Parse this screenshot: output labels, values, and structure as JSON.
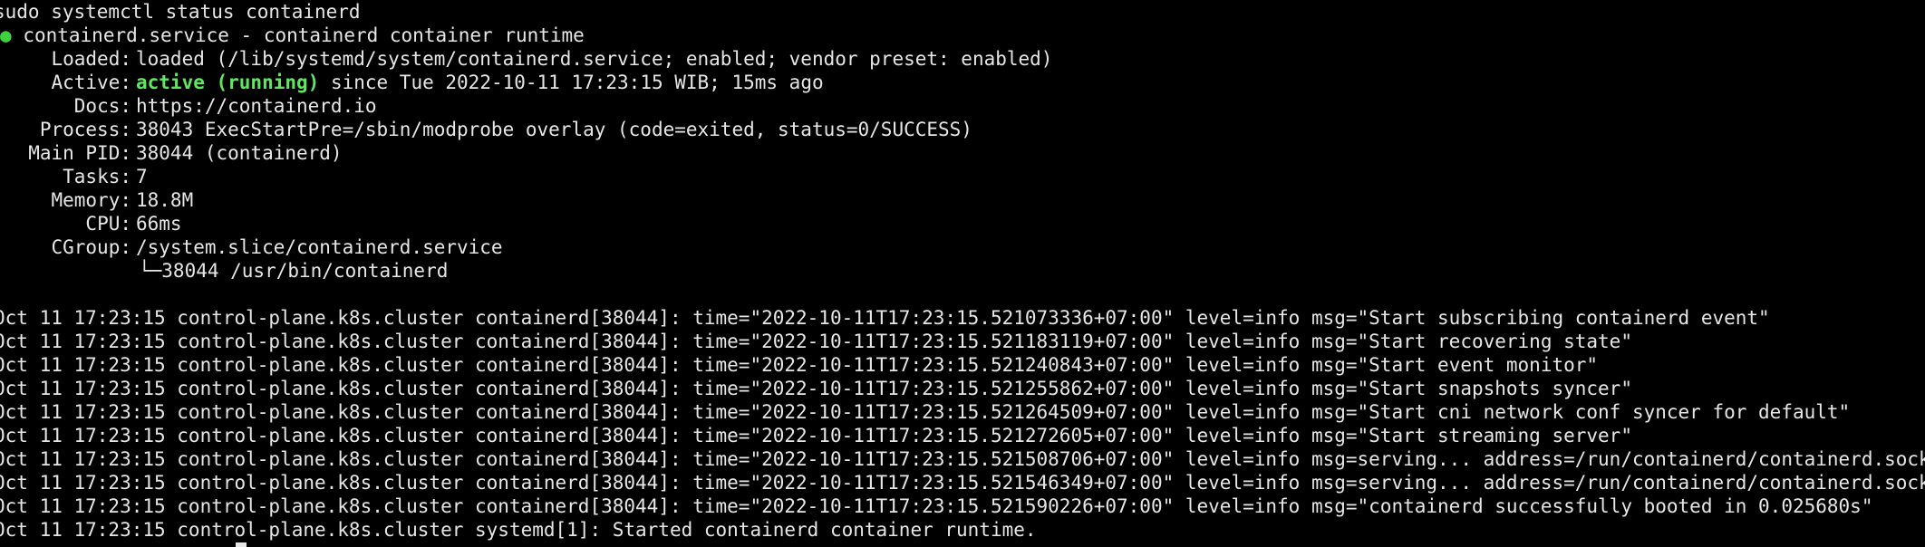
{
  "command": "sudo systemctl status containerd",
  "unit": {
    "bullet": "●",
    "title": "containerd.service - containerd container runtime",
    "loaded": {
      "label": "Loaded:",
      "value": "loaded (/lib/systemd/system/containerd.service; enabled; vendor preset: enabled)"
    },
    "active": {
      "label": "Active:",
      "state": "active (running)",
      "since": "since Tue 2022-10-11 17:23:15 WIB; 15ms ago"
    },
    "docs": {
      "label": "Docs:",
      "value": "https://containerd.io"
    },
    "process": {
      "label": "Process:",
      "value": "38043 ExecStartPre=/sbin/modprobe overlay (code=exited, status=0/SUCCESS)"
    },
    "main_pid": {
      "label": "Main PID:",
      "value": "38044 (containerd)"
    },
    "tasks": {
      "label": "Tasks:",
      "value": "7"
    },
    "memory": {
      "label": "Memory:",
      "value": "18.8M"
    },
    "cpu": {
      "label": "CPU:",
      "value": "66ms"
    },
    "cgroup": {
      "label": "CGroup:",
      "value": "/system.slice/containerd.service",
      "child": "└─38044 /usr/bin/containerd"
    }
  },
  "log_lines": [
    "Oct 11 17:23:15 control-plane.k8s.cluster containerd[38044]: time=\"2022-10-11T17:23:15.521073336+07:00\" level=info msg=\"Start subscribing containerd event\"",
    "Oct 11 17:23:15 control-plane.k8s.cluster containerd[38044]: time=\"2022-10-11T17:23:15.521183119+07:00\" level=info msg=\"Start recovering state\"",
    "Oct 11 17:23:15 control-plane.k8s.cluster containerd[38044]: time=\"2022-10-11T17:23:15.521240843+07:00\" level=info msg=\"Start event monitor\"",
    "Oct 11 17:23:15 control-plane.k8s.cluster containerd[38044]: time=\"2022-10-11T17:23:15.521255862+07:00\" level=info msg=\"Start snapshots syncer\"",
    "Oct 11 17:23:15 control-plane.k8s.cluster containerd[38044]: time=\"2022-10-11T17:23:15.521264509+07:00\" level=info msg=\"Start cni network conf syncer for default\"",
    "Oct 11 17:23:15 control-plane.k8s.cluster containerd[38044]: time=\"2022-10-11T17:23:15.521272605+07:00\" level=info msg=\"Start streaming server\"",
    "Oct 11 17:23:15 control-plane.k8s.cluster containerd[38044]: time=\"2022-10-11T17:23:15.521508706+07:00\" level=info msg=serving... address=/run/containerd/containerd.sock.ttrpc",
    "Oct 11 17:23:15 control-plane.k8s.cluster containerd[38044]: time=\"2022-10-11T17:23:15.521546349+07:00\" level=info msg=serving... address=/run/containerd/containerd.sock",
    "Oct 11 17:23:15 control-plane.k8s.cluster containerd[38044]: time=\"2022-10-11T17:23:15.521590226+07:00\" level=info msg=\"containerd successfully booted in 0.025680s\"",
    "Oct 11 17:23:15 control-plane.k8s.cluster systemd[1]: Started containerd container runtime."
  ]
}
